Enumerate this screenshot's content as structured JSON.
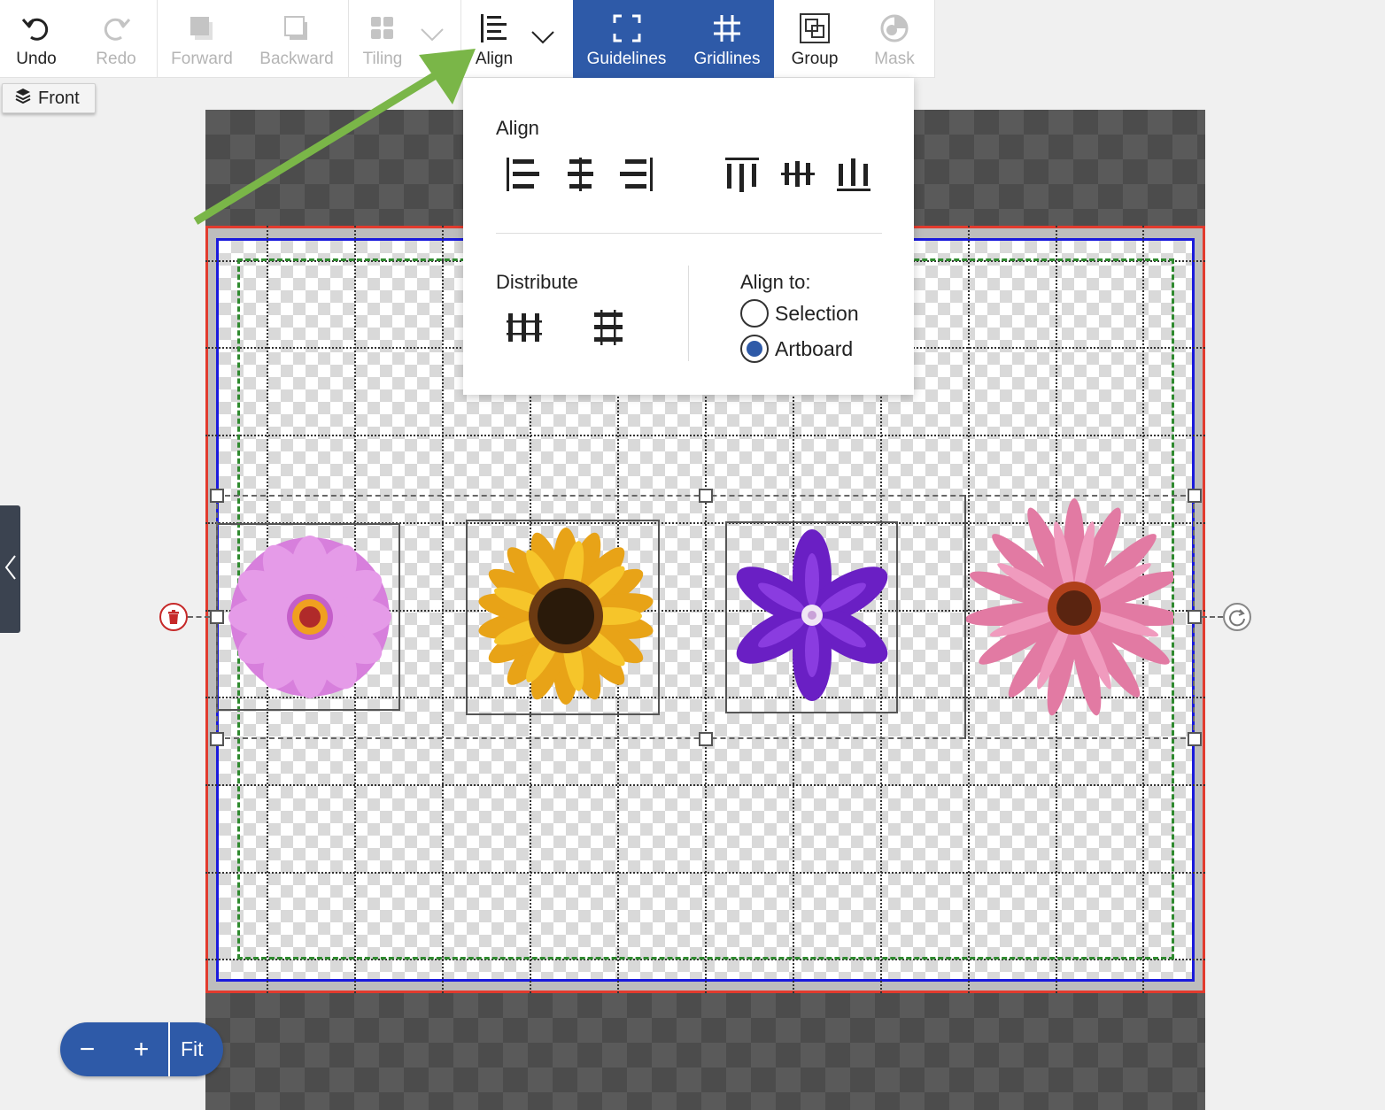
{
  "toolbar": {
    "undo": "Undo",
    "redo": "Redo",
    "forward": "Forward",
    "backward": "Backward",
    "tiling": "Tiling",
    "align": "Align",
    "guidelines": "Guidelines",
    "gridlines": "Gridlines",
    "group": "Group",
    "mask": "Mask"
  },
  "front_button": "Front",
  "align_popup": {
    "align_title": "Align",
    "distribute_title": "Distribute",
    "align_to_title": "Align to:",
    "options": [
      {
        "label": "Selection",
        "selected": false
      },
      {
        "label": "Artboard",
        "selected": true
      }
    ]
  },
  "zoom": {
    "minus": "−",
    "plus": "+",
    "fit": "Fit"
  },
  "canvas": {
    "images": [
      "pink-zinnia",
      "sunflower",
      "purple-clematis",
      "pink-coneflower"
    ]
  },
  "colors": {
    "accent": "#2e5aa8",
    "artboard_border": "#e23b2e",
    "bleed_border": "#1a1adc",
    "safe_line": "#2f8a2f",
    "arrow": "#7ab648"
  }
}
